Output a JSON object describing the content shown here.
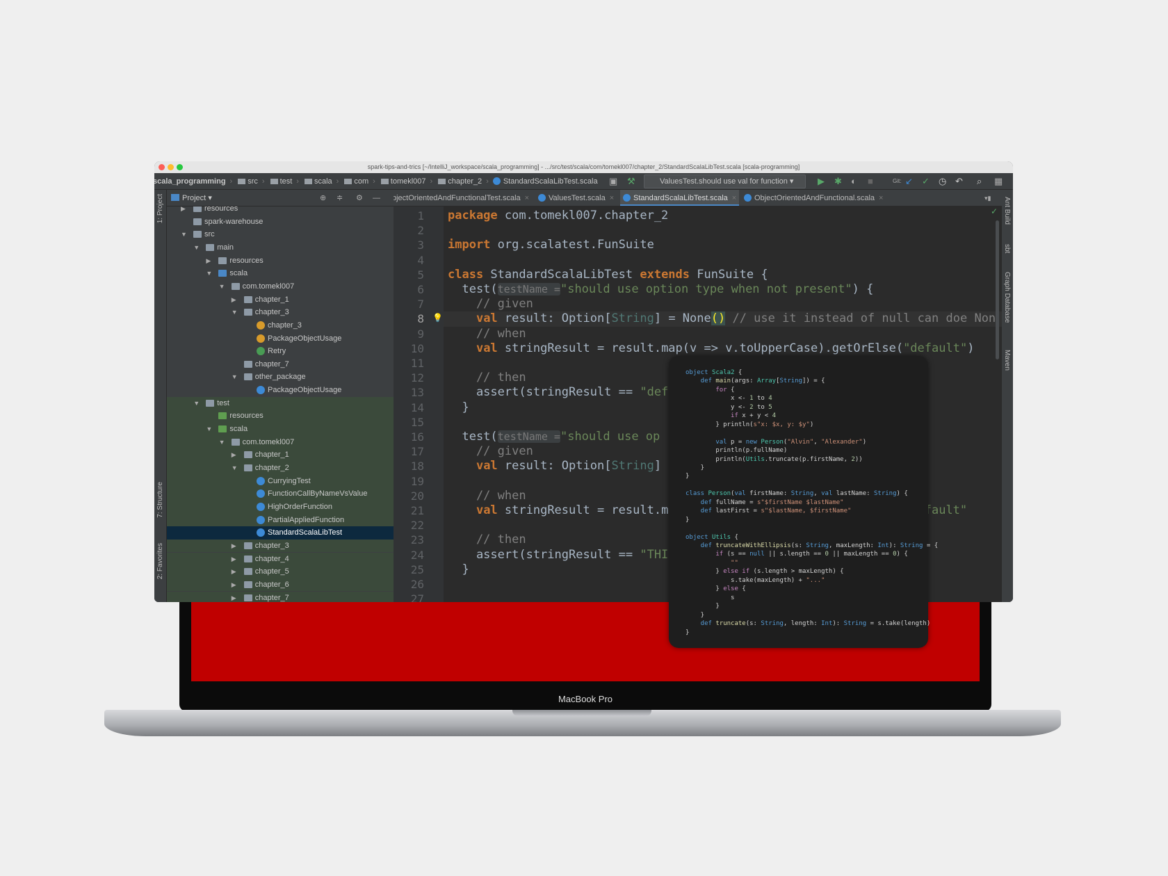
{
  "window": {
    "title": "spark-tips-and-trics [~/IntelliJ_workspace/scala_programming] - .../src/test/scala/com/tomekl007/chapter_2/StandardScalaLibTest.scala [scala-programming]"
  },
  "breadcrumb": [
    "scala_programming",
    "src",
    "test",
    "scala",
    "com",
    "tomekl007",
    "chapter_2",
    "StandardScalaLibTest.scala"
  ],
  "run_config": "ValuesTest.should use val for function",
  "toolbar_icons": [
    "run-icon",
    "debug-icon",
    "coverage-icon",
    "stop-icon",
    "git-icon",
    "vcs-update-icon",
    "vcs-commit-icon",
    "history-icon",
    "revert-icon",
    "search-icon",
    "project-structure-icon"
  ],
  "project_panel": {
    "title": "Project"
  },
  "left_strip": [
    "1: Project",
    "7: Structure",
    "2: Favorites"
  ],
  "right_strip": [
    "Ant Build",
    "sbt",
    "Graph Database",
    "Maven"
  ],
  "tree": [
    {
      "label": "resources",
      "level": 1,
      "arrow": "right",
      "icon": "folder"
    },
    {
      "label": "spark-warehouse",
      "level": 1,
      "arrow": "",
      "icon": "folder"
    },
    {
      "label": "src",
      "level": 1,
      "arrow": "down",
      "icon": "folder"
    },
    {
      "label": "main",
      "level": 2,
      "arrow": "down",
      "icon": "folder"
    },
    {
      "label": "resources",
      "level": 3,
      "arrow": "right",
      "icon": "folder"
    },
    {
      "label": "scala",
      "level": 3,
      "arrow": "down",
      "icon": "src"
    },
    {
      "label": "com.tomekl007",
      "level": 4,
      "arrow": "down",
      "icon": "folder"
    },
    {
      "label": "chapter_1",
      "level": 5,
      "arrow": "right",
      "icon": "folder"
    },
    {
      "label": "chapter_3",
      "level": 5,
      "arrow": "down",
      "icon": "folder"
    },
    {
      "label": "chapter_3",
      "level": 6,
      "arrow": "",
      "icon": "o"
    },
    {
      "label": "PackageObjectUsage",
      "level": 6,
      "arrow": "",
      "icon": "o"
    },
    {
      "label": "Retry",
      "level": 6,
      "arrow": "",
      "icon": "g"
    },
    {
      "label": "chapter_7",
      "level": 5,
      "arrow": "",
      "icon": "folder"
    },
    {
      "label": "other_package",
      "level": 5,
      "arrow": "down",
      "icon": "folder"
    },
    {
      "label": "PackageObjectUsage",
      "level": 6,
      "arrow": "",
      "icon": "c"
    },
    {
      "label": "test",
      "level": 2,
      "arrow": "down",
      "icon": "folder",
      "green": true
    },
    {
      "label": "resources",
      "level": 3,
      "arrow": "",
      "icon": "tst",
      "green": true
    },
    {
      "label": "scala",
      "level": 3,
      "arrow": "down",
      "icon": "tst",
      "green": true
    },
    {
      "label": "com.tomekl007",
      "level": 4,
      "arrow": "down",
      "icon": "folder",
      "green": true
    },
    {
      "label": "chapter_1",
      "level": 5,
      "arrow": "right",
      "icon": "folder",
      "green": true
    },
    {
      "label": "chapter_2",
      "level": 5,
      "arrow": "down",
      "icon": "folder",
      "green": true
    },
    {
      "label": "CurryingTest",
      "level": 6,
      "arrow": "",
      "icon": "c",
      "green": true
    },
    {
      "label": "FunctionCallByNameVsValue",
      "level": 6,
      "arrow": "",
      "icon": "c",
      "green": true
    },
    {
      "label": "HighOrderFunction",
      "level": 6,
      "arrow": "",
      "icon": "c",
      "green": true
    },
    {
      "label": "PartialAppliedFunction",
      "level": 6,
      "arrow": "",
      "icon": "c",
      "green": true
    },
    {
      "label": "StandardScalaLibTest",
      "level": 6,
      "arrow": "",
      "icon": "c",
      "selected": true
    },
    {
      "label": "chapter_3",
      "level": 5,
      "arrow": "right",
      "icon": "folder",
      "green": true
    },
    {
      "label": "chapter_4",
      "level": 5,
      "arrow": "right",
      "icon": "folder",
      "green": true
    },
    {
      "label": "chapter_5",
      "level": 5,
      "arrow": "right",
      "icon": "folder",
      "green": true
    },
    {
      "label": "chapter_6",
      "level": 5,
      "arrow": "right",
      "icon": "folder",
      "green": true
    },
    {
      "label": "chapter_7",
      "level": 5,
      "arrow": "right",
      "icon": "folder",
      "green": true
    }
  ],
  "tabs": [
    {
      "label": "bjectOrientedAndFunctionalTest.scala",
      "active": false
    },
    {
      "label": "ValuesTest.scala",
      "active": false
    },
    {
      "label": "StandardScalaLibTest.scala",
      "active": true
    },
    {
      "label": "ObjectOrientedAndFunctional.scala",
      "active": false
    }
  ],
  "editor": {
    "current_line": 8,
    "lines": [
      [
        [
          "package ",
          "k"
        ],
        [
          "com.tomekl007.chapter_2",
          "p"
        ]
      ],
      [],
      [
        [
          "import ",
          "k"
        ],
        [
          "org.scalatest.FunSuite",
          "p"
        ]
      ],
      [],
      [
        [
          "class ",
          "k"
        ],
        [
          "StandardScalaLibTest ",
          "p"
        ],
        [
          "extends ",
          "k"
        ],
        [
          "FunSuite {",
          "p"
        ]
      ],
      [
        [
          "  test(",
          "p"
        ],
        [
          "testName =",
          "h"
        ],
        [
          "\"should use option type when not present\"",
          "s"
        ],
        [
          ") {",
          "p"
        ]
      ],
      [
        [
          "    // given",
          "c"
        ]
      ],
      [
        [
          "    ",
          "p"
        ],
        [
          "val",
          "k"
        ],
        [
          " result: Option[",
          "p"
        ],
        [
          "String",
          "t"
        ],
        [
          "] = None",
          "p"
        ],
        [
          "()",
          "y"
        ],
        [
          " // use it instead of null can doe Non",
          "c"
        ]
      ],
      [
        [
          "    // when",
          "c"
        ]
      ],
      [
        [
          "    ",
          "p"
        ],
        [
          "val",
          "k"
        ],
        [
          " stringResult = result.map(v => v.toUpperCase).getOrElse(",
          "p"
        ],
        [
          "\"default\"",
          "s"
        ],
        [
          ")",
          "p"
        ]
      ],
      [],
      [
        [
          "    // then",
          "c"
        ]
      ],
      [
        [
          "    assert(stringResult == ",
          "p"
        ],
        [
          "\"def",
          "s"
        ]
      ],
      [
        [
          "  }",
          "p"
        ]
      ],
      [],
      [
        [
          "  test(",
          "p"
        ],
        [
          "testName =",
          "h"
        ],
        [
          "\"should use op",
          "s"
        ]
      ],
      [
        [
          "    // given",
          "c"
        ]
      ],
      [
        [
          "    ",
          "p"
        ],
        [
          "val",
          "k"
        ],
        [
          " result: Option[",
          "p"
        ],
        [
          "String",
          "t"
        ],
        [
          "]",
          "p"
        ]
      ],
      [],
      [
        [
          "    // when",
          "c"
        ]
      ],
      [
        [
          "    ",
          "p"
        ],
        [
          "val",
          "k"
        ],
        [
          " stringResult = result.m",
          "p"
        ],
        [
          "fault\"",
          "r s"
        ],
        [
          "",
          ""
        ]
      ],
      [],
      [
        [
          "    // then",
          "c"
        ]
      ],
      [
        [
          "    assert(stringResult == ",
          "p"
        ],
        [
          "\"THI",
          "s"
        ]
      ],
      [
        [
          "  }",
          "p"
        ]
      ],
      []
    ]
  },
  "popup": [
    [
      [
        "object ",
        "pk"
      ],
      [
        "Scala2 ",
        "pn"
      ],
      [
        "{",
        "p"
      ]
    ],
    [
      [
        "    def ",
        "pk"
      ],
      [
        "main",
        "pf"
      ],
      [
        "(args: ",
        "p"
      ],
      [
        "Array",
        "pn"
      ],
      [
        "[",
        "p"
      ],
      [
        "String",
        "pk"
      ],
      [
        "]) = {",
        "p"
      ]
    ],
    [
      [
        "        for ",
        "pc"
      ],
      [
        "{",
        "p"
      ]
    ],
    [
      [
        "            x <- ",
        "p"
      ],
      [
        "1",
        "pm"
      ],
      [
        " to ",
        "p"
      ],
      [
        "4",
        "pm"
      ]
    ],
    [
      [
        "            y <- ",
        "p"
      ],
      [
        "2",
        "pm"
      ],
      [
        " to ",
        "p"
      ],
      [
        "5",
        "pm"
      ]
    ],
    [
      [
        "            if ",
        "pc"
      ],
      [
        "x + y < ",
        "p"
      ],
      [
        "4",
        "pm"
      ]
    ],
    [
      [
        "        } println(",
        "p"
      ],
      [
        "s\"x: $x, y: $y\"",
        "ps"
      ],
      [
        ")",
        "p"
      ]
    ],
    [],
    [
      [
        "        val ",
        "pk"
      ],
      [
        "p = ",
        "p"
      ],
      [
        "new ",
        "pk"
      ],
      [
        "Person",
        "pn"
      ],
      [
        "(",
        "p"
      ],
      [
        "\"Alvin\"",
        "ps"
      ],
      [
        ", ",
        "p"
      ],
      [
        "\"Alexander\"",
        "ps"
      ],
      [
        ")",
        "p"
      ]
    ],
    [
      [
        "        println(p.fullName)",
        "p"
      ]
    ],
    [
      [
        "        println(",
        "p"
      ],
      [
        "Utils",
        "pn"
      ],
      [
        ".truncate(p.firstName, ",
        "p"
      ],
      [
        "2",
        "pm"
      ],
      [
        "))",
        "p"
      ]
    ],
    [
      [
        "    }",
        "p"
      ]
    ],
    [
      [
        "}",
        "p"
      ]
    ],
    [],
    [
      [
        "class ",
        "pk"
      ],
      [
        "Person",
        "pn"
      ],
      [
        "(",
        "p"
      ],
      [
        "val ",
        "pk"
      ],
      [
        "firstName: ",
        "p"
      ],
      [
        "String",
        "pk"
      ],
      [
        ", ",
        "p"
      ],
      [
        "val ",
        "pk"
      ],
      [
        "lastName: ",
        "p"
      ],
      [
        "String",
        "pk"
      ],
      [
        ") {",
        "p"
      ]
    ],
    [
      [
        "    def ",
        "pk"
      ],
      [
        "fullName = ",
        "p"
      ],
      [
        "s\"$firstName $lastName\"",
        "ps"
      ]
    ],
    [
      [
        "    def ",
        "pk"
      ],
      [
        "lastFirst = ",
        "p"
      ],
      [
        "s\"$lastName, $firstName\"",
        "ps"
      ]
    ],
    [
      [
        "}",
        "p"
      ]
    ],
    [],
    [
      [
        "object ",
        "pk"
      ],
      [
        "Utils ",
        "pn"
      ],
      [
        "{",
        "p"
      ]
    ],
    [
      [
        "    def ",
        "pk"
      ],
      [
        "truncateWithEllipsis",
        "pf"
      ],
      [
        "(s: ",
        "p"
      ],
      [
        "String",
        "pk"
      ],
      [
        ", maxLength: ",
        "p"
      ],
      [
        "Int",
        "pk"
      ],
      [
        "): ",
        "p"
      ],
      [
        "String",
        "pk"
      ],
      [
        " = {",
        "p"
      ]
    ],
    [
      [
        "        if ",
        "pc"
      ],
      [
        "(s == ",
        "p"
      ],
      [
        "null",
        "pk"
      ],
      [
        " || s.length == ",
        "p"
      ],
      [
        "0",
        "pm"
      ],
      [
        " || maxLength == ",
        "p"
      ],
      [
        "0",
        "pm"
      ],
      [
        ") {",
        "p"
      ]
    ],
    [
      [
        "            \"\"",
        "ps"
      ]
    ],
    [
      [
        "        } ",
        "p"
      ],
      [
        "else if ",
        "pc"
      ],
      [
        "(s.length > maxLength) {",
        "p"
      ]
    ],
    [
      [
        "            s.take(maxLength) + ",
        "p"
      ],
      [
        "\"...\"",
        "ps"
      ]
    ],
    [
      [
        "        } ",
        "p"
      ],
      [
        "else ",
        "pc"
      ],
      [
        "{",
        "p"
      ]
    ],
    [
      [
        "            s",
        "p"
      ]
    ],
    [
      [
        "        }",
        "p"
      ]
    ],
    [
      [
        "    }",
        "p"
      ]
    ],
    [
      [
        "    def ",
        "pk"
      ],
      [
        "truncate",
        "pf"
      ],
      [
        "(s: ",
        "p"
      ],
      [
        "String",
        "pk"
      ],
      [
        ", length: ",
        "p"
      ],
      [
        "Int",
        "pk"
      ],
      [
        "): ",
        "p"
      ],
      [
        "String",
        "pk"
      ],
      [
        " = s.take(length)",
        "p"
      ]
    ],
    [
      [
        "}",
        "p"
      ]
    ]
  ],
  "laptop": {
    "brand": "MacBook Pro",
    "screen_color": "#c00000"
  }
}
